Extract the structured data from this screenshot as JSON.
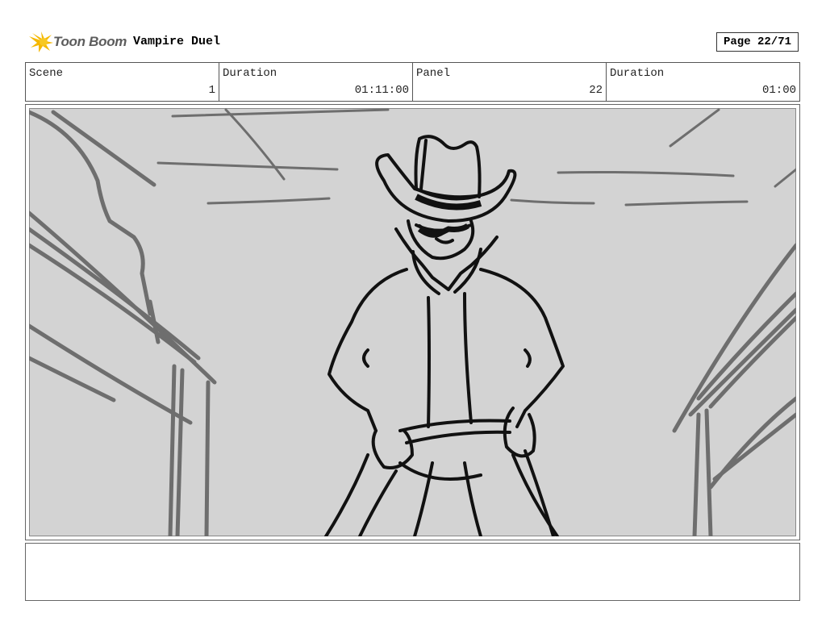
{
  "header": {
    "logo_text": "Toon Boom",
    "project_title": "Vampire Duel",
    "page_indicator": "Page 22/71"
  },
  "info": {
    "scene_label": "Scene",
    "scene_value": "1",
    "scene_duration_label": "Duration",
    "scene_duration_value": "01:11:00",
    "panel_label": "Panel",
    "panel_value": "22",
    "panel_duration_label": "Duration",
    "panel_duration_value": "01:00"
  },
  "notes": {
    "text": ""
  },
  "colors": {
    "sketch_background": "#d3d3d3",
    "sketch_gray_lines": "#6e6e6e",
    "sketch_ink": "#111111",
    "logo_star": "#f5b800"
  }
}
